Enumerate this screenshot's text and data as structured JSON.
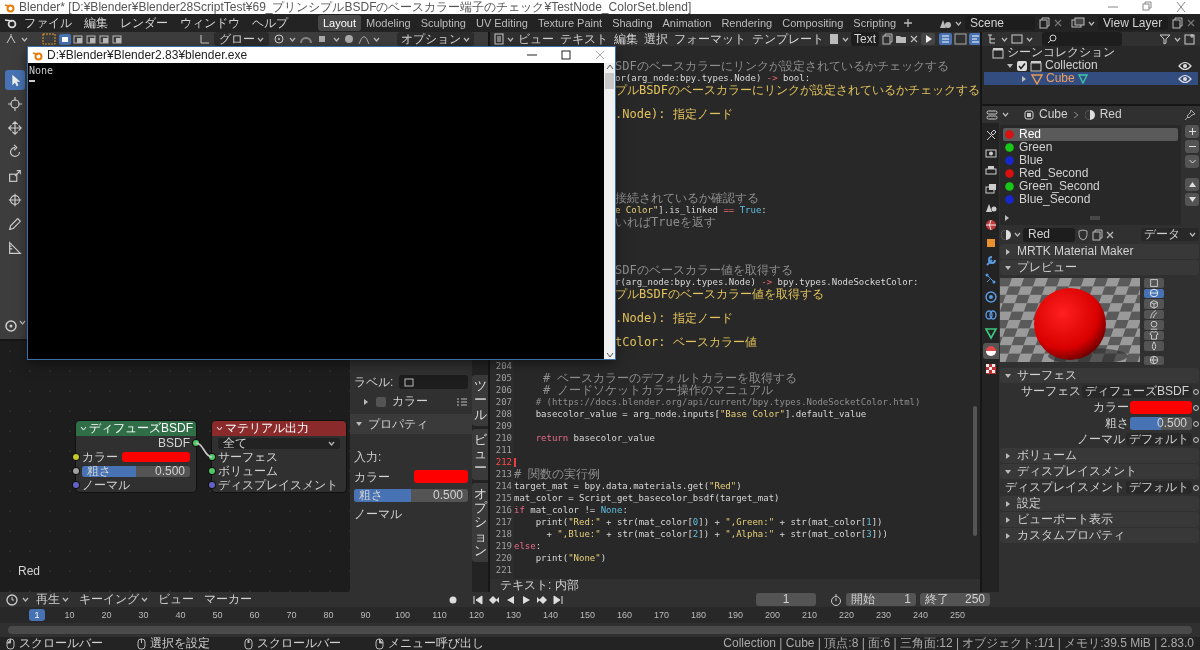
{
  "window": {
    "title": "Blender* [D:¥Blender¥Blender28ScriptTest¥69_プリンシプルBSDFのベースカラー端子のチェック¥TestNode_ColorSet.blend]"
  },
  "menu_bar": {
    "menus": [
      "ファイル",
      "編集",
      "レンダー",
      "ウィンドウ",
      "ヘルプ"
    ],
    "workspaces": [
      {
        "label": "Layout",
        "selected": true
      },
      {
        "label": "Modeling",
        "selected": false
      },
      {
        "label": "Sculpting",
        "selected": false
      },
      {
        "label": "UV Editing",
        "selected": false
      },
      {
        "label": "Texture Paint",
        "selected": false
      },
      {
        "label": "Shading",
        "selected": false
      },
      {
        "label": "Animation",
        "selected": false
      },
      {
        "label": "Rendering",
        "selected": false
      },
      {
        "label": "Compositing",
        "selected": false
      },
      {
        "label": "Scripting",
        "selected": false
      }
    ],
    "scene": "Scene",
    "view_layer": "View Layer"
  },
  "viewport": {
    "orientation": "グロー",
    "options": "オプション",
    "tools": [
      {
        "kind": "select",
        "selected": true
      },
      {
        "kind": "cursor",
        "selected": false
      },
      {
        "kind": "move",
        "selected": false
      },
      {
        "kind": "rotate",
        "selected": false
      },
      {
        "kind": "scale",
        "selected": false
      },
      {
        "kind": "transform",
        "selected": false
      },
      {
        "kind": "annotate",
        "selected": false
      },
      {
        "kind": "measure",
        "selected": false
      }
    ]
  },
  "node_editor": {
    "nodes": [
      {
        "kind": "shader",
        "title": "ディフューズBSDF",
        "output": "BSDF",
        "inputs": [
          {
            "kind": "color",
            "label": "カラー"
          },
          {
            "kind": "slider",
            "label": "粗さ",
            "value": "0.500",
            "level": 0.5
          },
          {
            "kind": "vector",
            "label": "ノーマル"
          }
        ]
      },
      {
        "kind": "output",
        "title": "マテリアル出力",
        "target": "全て",
        "inputs": [
          {
            "kind": "shader",
            "label": "サーフェス"
          },
          {
            "kind": "shader",
            "label": "ボリューム"
          },
          {
            "kind": "vector",
            "label": "ディスプレイスメント"
          }
        ]
      }
    ],
    "material_label": "Red",
    "sidebar": {
      "label_field": "ラベル:",
      "color_toggle": {
        "label": "カラー",
        "checked": false,
        "expanded": false
      },
      "panel": {
        "title": "プロパティ",
        "expanded": true
      },
      "input_heading": "入力:",
      "color_label": "カラー",
      "roughness": {
        "label": "粗さ",
        "value": "0.500",
        "level": 0.5
      },
      "normal": "ノーマル"
    },
    "tabs": [
      "ツール",
      "ビュー",
      "オプション"
    ]
  },
  "text_editor": {
    "menus": [
      "ビュー",
      "テキスト",
      "編集",
      "選択",
      "フォーマット",
      "テンプレート"
    ],
    "text_name": "Text",
    "lines": [
      {
        "kind": "fragment",
        "segments": [
          {
            "text": "SDFのベースカラーにリンクが設定されているかチェックする",
            "kind": "comment"
          }
        ]
      },
      {
        "kind": "fragment",
        "segments": [
          {
            "text": "or(arg_node:bpy.types.Node) ",
            "kind": "plain"
          },
          {
            "text": "->",
            "kind": "op"
          },
          {
            "text": " bool:",
            "kind": "plain"
          }
        ]
      },
      {
        "kind": "fragment",
        "segments": [
          {
            "text": "プルBSDFのベースカラーにリンクが設定されているかチェックする",
            "kind": "docstring"
          }
        ]
      },
      {
        "kind": "blank"
      },
      {
        "kind": "fragment",
        "segments": [
          {
            "text": ".Node): 指定ノード",
            "kind": "docstring"
          }
        ]
      },
      {
        "kind": "blank"
      },
      {
        "kind": "blank"
      },
      {
        "kind": "blank"
      },
      {
        "kind": "blank"
      },
      {
        "kind": "blank"
      },
      {
        "kind": "blank"
      },
      {
        "kind": "fragment",
        "segments": [
          {
            "text": "接続されているか確認する",
            "kind": "comment"
          }
        ]
      },
      {
        "kind": "fragment",
        "segments": [
          {
            "text": "e Color\"",
            "kind": "string"
          },
          {
            "text": "].is_linked ",
            "kind": "plain"
          },
          {
            "text": "==",
            "kind": "op"
          },
          {
            "text": " True",
            "kind": "builtin"
          },
          {
            "text": ":",
            "kind": "plain"
          }
        ]
      },
      {
        "kind": "fragment",
        "segments": [
          {
            "text": "いればTrueを返す",
            "kind": "comment"
          }
        ]
      },
      {
        "kind": "blank"
      },
      {
        "kind": "blank"
      },
      {
        "kind": "blank"
      },
      {
        "kind": "fragment",
        "segments": [
          {
            "text": "SDFのベースカラー値を取得する",
            "kind": "comment"
          }
        ]
      },
      {
        "kind": "fragment",
        "segments": [
          {
            "text": "r(arg_node:bpy.types.Node) ",
            "kind": "plain"
          },
          {
            "text": "->",
            "kind": "op"
          },
          {
            "text": " bpy.types.NodeSocketColor:",
            "kind": "plain"
          }
        ]
      },
      {
        "kind": "fragment",
        "segments": [
          {
            "text": "プルBSDFのベースカラー値を取得する",
            "kind": "docstring"
          }
        ]
      },
      {
        "kind": "blank"
      },
      {
        "kind": "fragment",
        "segments": [
          {
            "text": ".Node): 指定ノード",
            "kind": "docstring"
          }
        ]
      },
      {
        "kind": "blank"
      },
      {
        "kind": "fragment",
        "segments": [
          {
            "text": "tColor: ベースカラー値",
            "kind": "docstring"
          }
        ]
      },
      {
        "kind": "blank"
      },
      {
        "kind": "line",
        "number": "204",
        "current": false
      },
      {
        "kind": "line",
        "number": "205",
        "current": false,
        "segments": [
          {
            "text": "    # ベースカラーのデフォルトカラーを取得する",
            "kind": "comment"
          }
        ]
      },
      {
        "kind": "line",
        "number": "206",
        "current": false,
        "segments": [
          {
            "text": "    # ノードソケットカラー操作のマニュアル",
            "kind": "comment"
          }
        ]
      },
      {
        "kind": "line",
        "number": "207",
        "current": false,
        "segments": [
          {
            "text": "    # (https://docs.blender.org/api/current/bpy.types.NodeSocketColor.html)",
            "kind": "comment"
          }
        ]
      },
      {
        "kind": "line",
        "number": "208",
        "current": false,
        "segments": [
          {
            "text": "    basecolor_value = arg_node.inputs[",
            "kind": "plain"
          },
          {
            "text": "\"Base Color\"",
            "kind": "string"
          },
          {
            "text": "].default_value",
            "kind": "plain"
          }
        ]
      },
      {
        "kind": "line",
        "number": "209",
        "current": false
      },
      {
        "kind": "line",
        "number": "210",
        "current": false,
        "segments": [
          {
            "text": "    return",
            "kind": "keyword"
          },
          {
            "text": " basecolor_value",
            "kind": "plain"
          }
        ]
      },
      {
        "kind": "line",
        "number": "211",
        "current": false
      },
      {
        "kind": "line",
        "number": "212",
        "current": true
      },
      {
        "kind": "line",
        "number": "213",
        "current": false,
        "segments": [
          {
            "text": "# 関数の実行例",
            "kind": "comment"
          }
        ]
      },
      {
        "kind": "line",
        "number": "214",
        "current": false,
        "segments": [
          {
            "text": "target_mat = bpy.data.materials.get(",
            "kind": "plain"
          },
          {
            "text": "\"Red\"",
            "kind": "string"
          },
          {
            "text": ")",
            "kind": "plain"
          }
        ]
      },
      {
        "kind": "line",
        "number": "215",
        "current": false,
        "segments": [
          {
            "text": "mat_color = Script_get_basecolor_bsdf(target_mat)",
            "kind": "plain"
          }
        ]
      },
      {
        "kind": "line",
        "number": "216",
        "current": false,
        "segments": [
          {
            "text": "if",
            "kind": "keyword"
          },
          {
            "text": " mat_color != ",
            "kind": "plain"
          },
          {
            "text": "None",
            "kind": "builtin"
          },
          {
            "text": ":",
            "kind": "plain"
          }
        ]
      },
      {
        "kind": "line",
        "number": "217",
        "current": false,
        "segments": [
          {
            "text": "    print(",
            "kind": "plain"
          },
          {
            "text": "\"Red:\"",
            "kind": "string"
          },
          {
            "text": " + str(mat_color[",
            "kind": "plain"
          },
          {
            "text": "0",
            "kind": "number"
          },
          {
            "text": "]) + ",
            "kind": "plain"
          },
          {
            "text": "\",Green:\"",
            "kind": "string"
          },
          {
            "text": " + str(mat_color[",
            "kind": "plain"
          },
          {
            "text": "1",
            "kind": "number"
          },
          {
            "text": "])",
            "kind": "plain"
          }
        ]
      },
      {
        "kind": "line",
        "number": "218",
        "current": false,
        "segments": [
          {
            "text": "      + ",
            "kind": "plain"
          },
          {
            "text": "\",Blue:\"",
            "kind": "string"
          },
          {
            "text": " + str(mat_color[",
            "kind": "plain"
          },
          {
            "text": "2",
            "kind": "number"
          },
          {
            "text": "]) + ",
            "kind": "plain"
          },
          {
            "text": "\",Alpha:\"",
            "kind": "string"
          },
          {
            "text": " + str(mat_color[",
            "kind": "plain"
          },
          {
            "text": "3",
            "kind": "number"
          },
          {
            "text": "]))",
            "kind": "plain"
          }
        ]
      },
      {
        "kind": "line",
        "number": "219",
        "current": false,
        "segments": [
          {
            "text": "else",
            "kind": "keyword"
          },
          {
            "text": ":",
            "kind": "plain"
          }
        ]
      },
      {
        "kind": "line",
        "number": "220",
        "current": false,
        "segments": [
          {
            "text": "    print(",
            "kind": "plain"
          },
          {
            "text": "\"None\"",
            "kind": "string"
          },
          {
            "text": ")",
            "kind": "plain"
          }
        ]
      },
      {
        "kind": "line",
        "number": "221",
        "current": false
      }
    ],
    "footer": "テキスト: 内部"
  },
  "outliner": {
    "rows": [
      {
        "kind": "scene",
        "label": "シーンコレクション",
        "selected": false,
        "children": [
          {
            "kind": "collection",
            "label": "Collection",
            "selected": false,
            "checked": true,
            "expanded": true,
            "children": [
              {
                "kind": "object",
                "label": "Cube",
                "selected": true,
                "expanded": false
              }
            ]
          }
        ]
      }
    ]
  },
  "properties": {
    "tabs": [
      {
        "kind": "tool",
        "selected": false
      },
      {
        "kind": "render",
        "selected": false
      },
      {
        "kind": "output",
        "selected": false
      },
      {
        "kind": "view_layer",
        "selected": false
      },
      {
        "kind": "scene",
        "selected": false
      },
      {
        "kind": "world",
        "selected": false
      },
      {
        "kind": "object",
        "selected": false
      },
      {
        "kind": "modifier",
        "selected": false
      },
      {
        "kind": "particles",
        "selected": false
      },
      {
        "kind": "physics",
        "selected": false
      },
      {
        "kind": "constraints",
        "selected": false
      },
      {
        "kind": "data",
        "selected": false
      },
      {
        "kind": "material",
        "selected": true
      },
      {
        "kind": "texture",
        "selected": false
      }
    ],
    "breadcrumb": [
      "Cube",
      "Red"
    ],
    "slots": [
      {
        "name": "Red",
        "color": "#d81010",
        "selected": true
      },
      {
        "name": "Green",
        "color": "#18c818",
        "selected": false
      },
      {
        "name": "Blue",
        "color": "#1828d0",
        "selected": false
      },
      {
        "name": "Red_Second",
        "color": "#d81010",
        "selected": false
      },
      {
        "name": "Green_Second",
        "color": "#18c818",
        "selected": false
      },
      {
        "name": "Blue_Second",
        "color": "#1828d0",
        "selected": false
      }
    ],
    "material": {
      "name": "Red",
      "link": "データ"
    },
    "panels": [
      {
        "title": "MRTK Material Maker",
        "expanded": false
      },
      {
        "kind": "preview",
        "title": "プレビュー",
        "expanded": true,
        "preview_types": [
          {
            "kind": "flat",
            "selected": false
          },
          {
            "kind": "sphere",
            "selected": true
          },
          {
            "kind": "cube",
            "selected": false
          },
          {
            "kind": "hair",
            "selected": false
          },
          {
            "kind": "head",
            "selected": false
          },
          {
            "kind": "cloth",
            "selected": false
          },
          {
            "kind": "fluid",
            "selected": false
          }
        ]
      },
      {
        "kind": "fields",
        "title": "サーフェス",
        "expanded": true,
        "fields": [
          {
            "kind": "dropdown",
            "label": "サーフェス",
            "value": "ディフューズBSDF"
          },
          {
            "kind": "color",
            "label": "カラー"
          },
          {
            "kind": "slider",
            "label": "粗さ",
            "value": "0.500",
            "level": 0.5
          },
          {
            "kind": "dropdown",
            "label": "ノーマル",
            "value": "デフォルト"
          }
        ]
      },
      {
        "title": "ボリューム",
        "expanded": false
      },
      {
        "kind": "fields",
        "title": "ディスプレイスメント",
        "expanded": true,
        "fields": [
          {
            "kind": "dropdown",
            "label": "ディスプレイスメント",
            "value": "デフォルト"
          }
        ]
      },
      {
        "title": "設定",
        "expanded": false
      },
      {
        "title": "ビューポート表示",
        "expanded": false
      },
      {
        "title": "カスタムプロパティ",
        "expanded": false
      }
    ]
  },
  "timeline": {
    "menus": [
      {
        "label": "再生",
        "dropdown": true
      },
      {
        "label": "キーイング",
        "dropdown": true
      },
      {
        "label": "ビュー",
        "dropdown": false
      },
      {
        "label": "マーカー",
        "dropdown": false
      }
    ],
    "current_frame": "1",
    "start_label": "開始",
    "start": "1",
    "end_label": "終了",
    "end": "250",
    "playhead": "1",
    "ticks": [
      "10",
      "20",
      "30",
      "40",
      "50",
      "60",
      "70",
      "80",
      "90",
      "100",
      "110",
      "120",
      "130",
      "140",
      "150",
      "160",
      "170",
      "180",
      "190",
      "200",
      "210",
      "220",
      "230",
      "240",
      "250"
    ]
  },
  "status_bar": {
    "hints": [
      {
        "kind": "mouse_left",
        "label": "スクロールバー"
      },
      {
        "kind": "mouse_drag",
        "label": "選択を設定"
      },
      {
        "kind": "mouse_middle",
        "label": "スクロールバー"
      },
      {
        "kind": "mouse_right",
        "label": "メニュー呼び出し"
      }
    ],
    "stats": "Collection | Cube | 頂点:8 | 面:6 | 三角面:12 | オブジェクト:1/1 | メモリ:39.5 MiB | 2.83.0"
  },
  "console": {
    "title": "D:¥Blender¥Blender2.83¥blender.exe",
    "output": "None"
  }
}
